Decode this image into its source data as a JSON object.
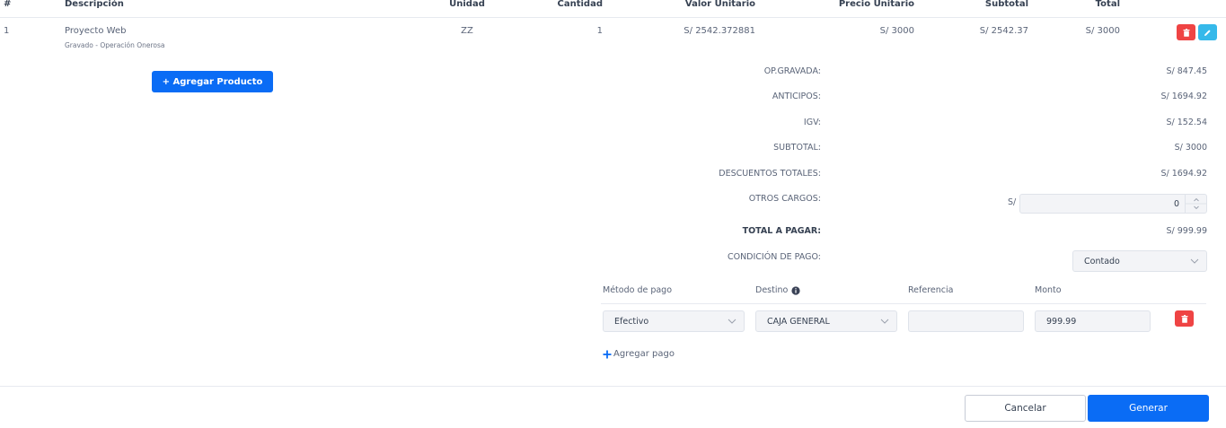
{
  "table": {
    "headers": {
      "num": "#",
      "descripcion": "Descripción",
      "unidad": "Unidad",
      "cantidad": "Cantidad",
      "valor_unitario": "Valor Unitario",
      "precio_unitario": "Precio Unitario",
      "subtotal": "Subtotal",
      "total": "Total"
    },
    "rows": [
      {
        "num": "1",
        "descripcion": "Proyecto Web",
        "detalle": "Gravado - Operación Onerosa",
        "unidad": "ZZ",
        "cantidad": "1",
        "valor_unitario": "S/ 2542.372881",
        "precio_unitario": "S/ 3000",
        "subtotal": "S/ 2542.37",
        "total": "S/ 3000"
      }
    ]
  },
  "actions": {
    "add_product": "+ Agregar Producto"
  },
  "summary": {
    "op_gravada_label": "OP.GRAVADA:",
    "op_gravada_value": "S/ 847.45",
    "anticipos_label": "ANTICIPOS:",
    "anticipos_value": "S/ 1694.92",
    "igv_label": "IGV:",
    "igv_value": "S/ 152.54",
    "subtotal_label": "SUBTOTAL:",
    "subtotal_value": "S/ 3000",
    "descuentos_label": "DESCUENTOS TOTALES:",
    "descuentos_value": "S/ 1694.92",
    "otros_cargos_label": "OTROS CARGOS:",
    "otros_cargos_currency": "S/",
    "otros_cargos_value": "0",
    "total_label": "TOTAL A PAGAR:",
    "total_value": "S/ 999.99",
    "condicion_label": "CONDICIÓN DE PAGO:",
    "condicion_value": "Contado"
  },
  "payments": {
    "headers": {
      "metodo": "Método de pago",
      "destino": "Destino",
      "referencia": "Referencia",
      "monto": "Monto"
    },
    "rows": [
      {
        "metodo": "Efectivo",
        "destino": "CAJA GENERAL",
        "referencia": "",
        "monto": "999.99"
      }
    ],
    "add_label": "Agregar pago"
  },
  "footer": {
    "cancel": "Cancelar",
    "generate": "Generar"
  },
  "colors": {
    "primary": "#0a6cf5",
    "danger": "#ef4444",
    "info": "#36b9ea"
  },
  "icons": {
    "delete": "trash-icon",
    "edit": "pencil-icon",
    "info": "info-circle-icon",
    "add": "plus-icon",
    "dropdown": "chevron-down-icon",
    "spinner": "spinner-arrows-icon"
  }
}
